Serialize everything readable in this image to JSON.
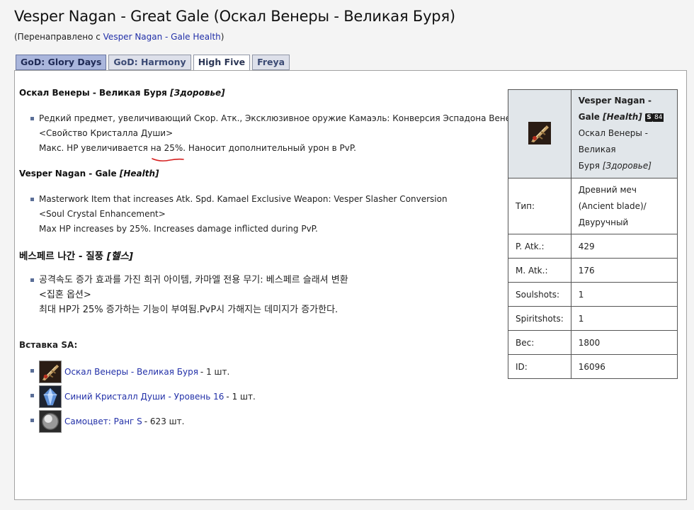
{
  "title": "Vesper Nagan - Great Gale (Оскал Венеры - Великая Буря)",
  "redirect": {
    "prefix": "(Перенаправлено с ",
    "link": "Vesper Nagan - Gale Health",
    "suffix": ")"
  },
  "tabs": [
    {
      "label": "GoD: Glory Days",
      "state": "blue"
    },
    {
      "label": "GoD: Harmony",
      "state": "normal"
    },
    {
      "label": "High Five",
      "state": "selected"
    },
    {
      "label": "Freya",
      "state": "normal"
    }
  ],
  "sections": [
    {
      "title_main": "Оскал Венеры - Великая Буря ",
      "title_italic": "[Здоровье]",
      "lines": [
        "Редкий предмет, увеличивающий Скор. Атк., Эксклюзивное оружие Камаэль: Конверсия Эспадона Венеры",
        "<Свойство Кристалла Души>",
        "Макс. HP увеличивается на 25%. Наносит дополнительный урон в PvP."
      ]
    },
    {
      "title_main": "Vesper Nagan - Gale ",
      "title_italic": "[Health]",
      "lines": [
        "Masterwork Item that increases Atk. Spd. Kamael Exclusive Weapon: Vesper Slasher Conversion",
        "<Soul Crystal Enhancement>",
        "Max HP increases by 25%. Increases damage inflicted during PvP."
      ]
    },
    {
      "title_main": "베스페르 나간 - 질풍 ",
      "title_italic": "[헬스]",
      "lines": [
        "공격속도 증가 효과를 가진 희귀 아이템, 카마엘 전용 무기: 베스페르 슬래셔 변환",
        "<집혼 옵션>",
        "최대 HP가 25% 증가하는 기능이 부여됨.PvP시 가해지는 데미지가 증가한다."
      ]
    }
  ],
  "sa": {
    "title": "Вставка SA:",
    "items": [
      {
        "link": "Оскал Венеры - Великая Буря",
        "suffix": "- 1 шт.",
        "icon": "weapon-icon"
      },
      {
        "link": "Синий Кристалл Души - Уровень 16",
        "suffix": "- 1 шт.",
        "icon": "blue-soul-crystal-icon"
      },
      {
        "link": "Самоцвет: Ранг S",
        "suffix": "- 623 шт.",
        "icon": "gemstone-icon"
      }
    ]
  },
  "infobox": {
    "name_line1": "Vesper Nagan -",
    "name_line2_main": "Gale ",
    "name_line2_italic": "[Health]",
    "grade_s": "S",
    "grade_84": "84",
    "ru_line1": "Оскал Венеры -",
    "ru_line2": "Великая",
    "ru_line3_main": "Буря ",
    "ru_line3_italic": "[Здоровье]",
    "rows": [
      {
        "label": "Тип:",
        "value_lines": [
          "Древний меч",
          "(Ancient blade)/",
          "Двуручный"
        ]
      },
      {
        "label": "P. Atk.:",
        "value": "429"
      },
      {
        "label": "M. Atk.:",
        "value": "176"
      },
      {
        "label": "Soulshots:",
        "value": "1"
      },
      {
        "label": "Spiritshots:",
        "value": "1"
      },
      {
        "label": "Вес:",
        "value": "1800"
      },
      {
        "label": "ID:",
        "value": "16096"
      }
    ]
  },
  "colors": {
    "link": "#2230a8",
    "tab_blue": "#aab6dc",
    "infobox_header": "#e1e6ea",
    "annotation": "#d62020"
  }
}
